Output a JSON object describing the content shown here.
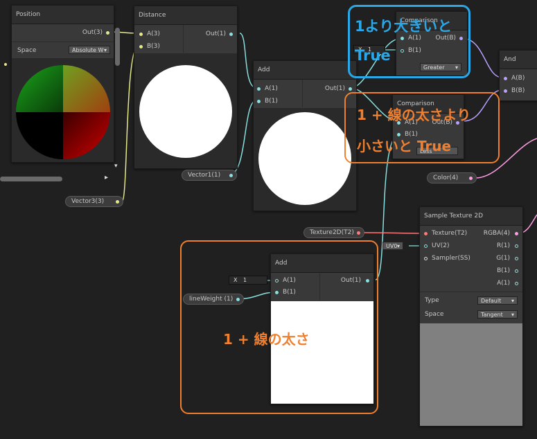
{
  "colors": {
    "background": "#202020",
    "node_body": "#393939",
    "node_header": "#2e2e2e",
    "wire_vec1": "#88e0e0",
    "wire_vec3": "#e6e88a",
    "wire_bool": "#b9a0ff",
    "wire_texture": "#ff7a7a",
    "wire_color": "#ff9de4",
    "annotation_blue": "#2aa7e6",
    "annotation_orange": "#f08030"
  },
  "nodes": {
    "position": {
      "title": "Position",
      "out_label": "Out(3)",
      "space_label": "Space",
      "space_value": "Absolute W",
      "dropdown_arrow": "▾"
    },
    "distance": {
      "title": "Distance",
      "in_a": "A(3)",
      "in_b": "B(3)",
      "out": "Out(1)"
    },
    "add_top": {
      "title": "Add",
      "in_a": "A(1)",
      "in_b": "B(1)",
      "out": "Out(1)"
    },
    "comparison_greater": {
      "title": "Comparison",
      "in_a": "A(1)",
      "in_b": "B(1)",
      "out": "Out(B)",
      "mode": "Greater",
      "inline_x_label": "X",
      "inline_x_value": "1"
    },
    "comparison_less": {
      "title": "Comparison",
      "in_a": "A(1)",
      "in_b": "B(1)",
      "out": "Out(B)",
      "mode": "Less"
    },
    "and": {
      "title": "And",
      "in_a": "A(B)",
      "in_b": "B(B)"
    },
    "add_bottom": {
      "title": "Add",
      "in_a": "A(1)",
      "in_b": "B(1)",
      "out": "Out(1)",
      "inline_x_label": "X",
      "inline_x_value": "1"
    },
    "sample_texture": {
      "title": "Sample Texture 2D",
      "in_texture": "Texture(T2)",
      "in_uv": "UV(2)",
      "in_sampler": "Sampler(SS)",
      "uv_value": "UV0",
      "out_rgba": "RGBA(4)",
      "out_r": "R(1)",
      "out_g": "G(1)",
      "out_b": "B(1)",
      "out_a": "A(1)",
      "type_label": "Type",
      "type_value": "Default",
      "space_label": "Space",
      "space_value": "Tangent"
    }
  },
  "properties": {
    "vector3": "Vector3(3)",
    "vector1": "Vector1(1)",
    "texture": "Texture2D(T2)",
    "color": "Color(4)",
    "line_weight": "lineWeight (1)"
  },
  "annotations": {
    "blue": "1より大きいと\nTrue",
    "blue_line1": "1より大きいと",
    "blue_line2": "True",
    "orange_top_line1": "1 + 線の太さより",
    "orange_top_line2": "小さいと True",
    "orange_bottom": "1 + 線の太さ"
  },
  "scroll": {
    "right_arrow": "▸",
    "down_arrow": "▾",
    "up_arrow": "▴"
  }
}
